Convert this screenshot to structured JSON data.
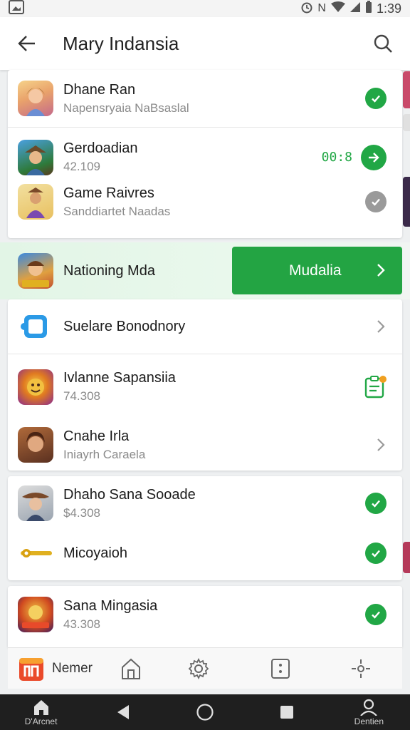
{
  "status": {
    "time": "1:39",
    "letter": "N"
  },
  "app_bar": {
    "title": "Mary Indansia"
  },
  "list": [
    {
      "title": "Dhane Ran",
      "subtitle": "Napensryaia NaBsaslal",
      "state": "check"
    },
    {
      "title": "Gerdoadian",
      "subtitle": "42.109",
      "state": "go",
      "timer": "00:8"
    },
    {
      "title": "Game Raivres",
      "subtitle": "Sanddiartet Naadas",
      "state": "check-gray"
    },
    {
      "title": "Suelare Bonodnory",
      "subtitle": "",
      "state": "chevron"
    },
    {
      "title": "Ivlanne Sapansiia",
      "subtitle": "74.308",
      "state": "clipboard"
    },
    {
      "title": "Cnahe Irla",
      "subtitle": "Iniayrh Caraela",
      "state": "chevron"
    },
    {
      "title": "Dhaho Sana Sooade",
      "subtitle": "$4.308",
      "state": "check"
    },
    {
      "title": "Micoyaioh",
      "subtitle": "",
      "state": "check"
    },
    {
      "title": "Sana Mingasia",
      "subtitle": "43.308",
      "state": "check"
    }
  ],
  "featured": {
    "title": "Nationing Mda",
    "cta": "Mudalia"
  },
  "bottom_tools": {
    "label": "Nemer"
  },
  "nav": {
    "left_label": "D'Arcnet",
    "right_label": "Dentien"
  },
  "colors": {
    "accent": "#21a745",
    "featured_bg": "#e4f6e8",
    "nav_bg": "#1f1f1f"
  }
}
